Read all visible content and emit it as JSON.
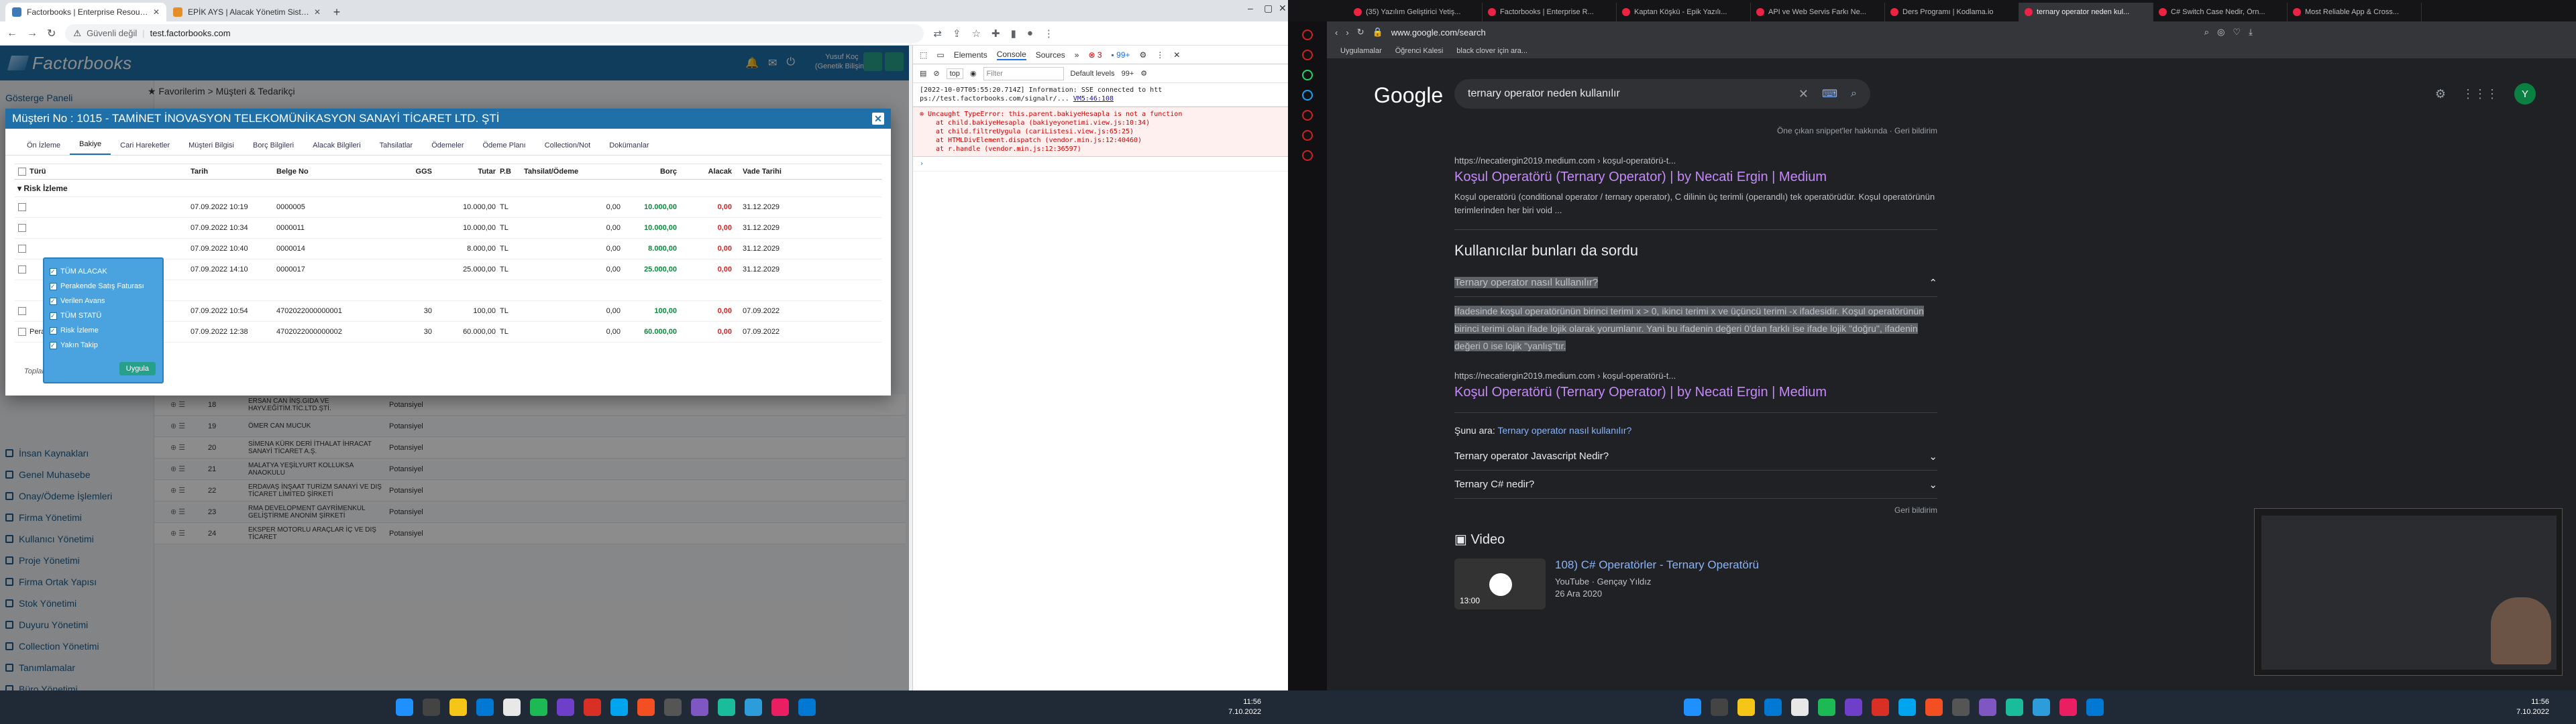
{
  "left_browser": {
    "tabs": [
      {
        "title": "Factorbooks | Enterprise Resource...",
        "active": true
      },
      {
        "title": "EPİK AYS | Alacak Yönetim Siste...",
        "active": false
      }
    ],
    "security": "Güvenli değil",
    "url": "test.factorbooks.com"
  },
  "app": {
    "brand": "Factorbooks",
    "user_name": "Yusuf Koç",
    "user_org": "(Genetik Bilişim)",
    "breadcrumb": "Favorilerim > Müşteri & Tedarikçi",
    "sidebar_top": "Gösterge Paneli",
    "sidebar_items": [
      "İnsan Kaynakları",
      "Genel Muhasebe",
      "Onay/Ödeme İşlemleri",
      "Firma Yönetimi",
      "Kullanıcı Yönetimi",
      "Proje Yönetimi",
      "Firma Ortak Yapısı",
      "Stok Yönetimi",
      "Duyuru Yönetimi",
      "Collection Yönetimi",
      "Tanımlamalar",
      "Büro Yönetimi"
    ],
    "bg_rows": [
      {
        "no": "18",
        "name": "ERSAN CAN İNŞ.GIDA VE HAYV.EĞİTİM.TİC.LTD.ŞTİ.",
        "status": "Potansiyel"
      },
      {
        "no": "19",
        "name": "Ömer Can Mucuk",
        "status": "Potansiyel"
      },
      {
        "no": "20",
        "name": "SİMENA KÜRK DERİ İTHALAT İHRACAT SANAYİ TİCARET A.Ş.",
        "status": "Potansiyel"
      },
      {
        "no": "21",
        "name": "MALATYA YEŞİLYURT KOLLUKSA ANAOKULU",
        "status": "Potansiyel"
      },
      {
        "no": "22",
        "name": "ERDAVAŞ İNŞAAT TURİZM SANAYİ VE DIŞ TİCARET LİMİTED ŞİRKETİ",
        "status": "Potansiyel"
      },
      {
        "no": "23",
        "name": "RMA DEVELOPMENT GAYRİMENKUL GELİŞTİRME ANONİM ŞİRKETİ",
        "status": "Potansiyel"
      },
      {
        "no": "24",
        "name": "EKSPER MOTORLU ARAÇLAR İÇ VE DIŞ TİCARET",
        "status": "Potansiyel"
      }
    ]
  },
  "modal": {
    "title": "Müşteri No : 1015 - TAMİNET İNOVASYON TELEKOMÜNİKASYON SANAYİ TİCARET LTD. ŞTİ",
    "tabs": [
      "Ön İzleme",
      "Bakiye",
      "Cari Hareketler",
      "Müşteri Bilgisi",
      "Borç Bilgileri",
      "Alacak Bilgileri",
      "Tahsilatlar",
      "Ödemeler",
      "Ödeme Planı",
      "Collection/Not",
      "Dokümanlar"
    ],
    "active_tab": "Bakiye",
    "columns": [
      "Türü",
      "Tarih",
      "Belge No",
      "GGS",
      "Tutar",
      "P.B",
      "Tahsilat/Ödeme",
      "Borç",
      "Alacak",
      "Vade Tarihi"
    ],
    "group": "Risk İzleme",
    "rows": [
      {
        "type": "",
        "date": "07.09.2022 10:19",
        "doc": "0000005",
        "ggs": "",
        "amount": "10.000,00",
        "pb": "TL",
        "tahsilat": "",
        "borc_a": "0,00",
        "borc": "10.000,00",
        "alacak": "0,00",
        "vade": "31.12.2029"
      },
      {
        "type": "",
        "date": "07.09.2022 10:34",
        "doc": "0000011",
        "ggs": "",
        "amount": "10.000,00",
        "pb": "TL",
        "tahsilat": "",
        "borc_a": "0,00",
        "borc": "10.000,00",
        "alacak": "0,00",
        "vade": "31.12.2029"
      },
      {
        "type": "",
        "date": "07.09.2022 10:40",
        "doc": "0000014",
        "ggs": "",
        "amount": "8.000,00",
        "pb": "TL",
        "tahsilat": "",
        "borc_a": "0,00",
        "borc": "8.000,00",
        "alacak": "0,00",
        "vade": "31.12.2029"
      },
      {
        "type": "",
        "date": "07.09.2022 14:10",
        "doc": "0000017",
        "ggs": "",
        "amount": "25.000,00",
        "pb": "TL",
        "tahsilat": "",
        "borc_a": "0,00",
        "borc": "25.000,00",
        "alacak": "0,00",
        "vade": "31.12.2029"
      },
      {
        "type": "",
        "date": "07.09.2022 10:54",
        "doc": "4702022000000001",
        "ggs": "30",
        "amount": "100,00",
        "pb": "TL",
        "tahsilat": "",
        "borc_a": "0,00",
        "borc": "100,00",
        "alacak": "0,00",
        "vade": "07.09.2022"
      },
      {
        "type": "Perakende Satış Faturası",
        "date": "07.09.2022 12:38",
        "doc": "4702022000000002",
        "ggs": "30",
        "amount": "60.000,00",
        "pb": "TL",
        "tahsilat": "",
        "borc_a": "0,00",
        "borc": "60.000,00",
        "alacak": "0,00",
        "vade": "07.09.2022"
      }
    ],
    "footer": "Toplam kayıt sayısı: 6",
    "filter_options": [
      "TÜM ALACAK",
      "Perakende Satış Faturası",
      "Verilen Avans",
      "TÜM STATÜ",
      "Risk İzleme",
      "Yakın Takip"
    ],
    "filter_button": "Uygula"
  },
  "devtools": {
    "tabs": [
      "Elements",
      "Console",
      "Sources"
    ],
    "active_tab": "Console",
    "context": "top",
    "filter_placeholder": "Filter",
    "levels": "Default levels",
    "issues": "99+",
    "errors": "3",
    "log1": "[2022-10-07T05:55:20.714Z] Information: SSE connected to htt ps://test.factorbooks.com/signalr/...",
    "log1_link": "VM5:46:108",
    "err_text": "Uncaught TypeError: this.parent.bakiyeHesapla is not a function",
    "err_stack": [
      "at child.bakiyeHesapla (bakiyeyonetimi.view.js:10:34)",
      "at child.filtreUygula (cariListesi.view.js:65:25)",
      "at HTMLDivElement.dispatch (vendor.min.js:12:40460)",
      "at r.handle (vendor.min.js:12:36597)"
    ]
  },
  "taskbar_left": {
    "time": "11:56",
    "date": "7.10.2022"
  },
  "right_browser": {
    "tabs": [
      {
        "title": "(35) Yazılım Geliştirici Yetiş...",
        "active": false
      },
      {
        "title": "Factorbooks | Enterprise R...",
        "active": false
      },
      {
        "title": "Kaptan Köşkü - Epik Yazılı...",
        "active": false
      },
      {
        "title": "API ve Web Servis Farkı Ne...",
        "active": false
      },
      {
        "title": "Ders Programı | Kodlama.io",
        "active": false
      },
      {
        "title": "ternary operator neden kul...",
        "active": true
      },
      {
        "title": "C# Switch Case Nedir, Örn...",
        "active": false
      },
      {
        "title": "Most Reliable App & Cross...",
        "active": false
      }
    ],
    "url": "www.google.com/search",
    "bookmarks": [
      "Uygulamalar",
      "Öğrenci Kalesi",
      "black clover için ara..."
    ]
  },
  "google": {
    "logo": "Google",
    "query": "ternary operator neden kullanılır",
    "avatar": "Y",
    "feat_note": "Öne çıkan snippet'ler hakkında · Geri bildirim",
    "result1": {
      "url": "https://necatiergin2019.medium.com › koşul-operatörü-t...",
      "title": "Koşul Operatörü (Ternary Operator) | by Necati Ergin | Medium",
      "snippet": "Koşul operatörü (conditional operator / ternary operator), C dilinin üç terimli (operandlı) tek operatörüdür. Koşul operatörünün terimlerinden her biri void ..."
    },
    "paa_title": "Kullanıcılar bunları da sordu",
    "paa_q1": "Ternary operator nasıl kullanılır?",
    "paa_answer": "İfadesinde koşul operatörünün birinci terimi x > 0, ikinci terimi x ve üçüncü terimi -x ifadesidir. Koşul operatörünün birinci terimi olan ifade lojik olarak yorumlanır. Yani bu ifadenin değeri 0'dan farklı ise ifade lojik \"doğru\", ifadenin değeri 0 ise lojik \"yanlış\"tır.",
    "result2": {
      "url": "https://necatiergin2019.medium.com › koşul-operatörü-t...",
      "title": "Koşul Operatörü (Ternary Operator) | by Necati Ergin | Medium"
    },
    "also_search_label": "Şunu ara:",
    "also_search_link": "Ternary operator nasıl kullanılır?",
    "paa_q2": "Ternary operator Javascript Nedir?",
    "paa_q3": "Ternary C# nedir?",
    "feedback": "Geri bildirim",
    "video_section": "Video",
    "video": {
      "title": "108) C# Operatörler - Ternary Operatörü",
      "duration": "13:00",
      "source": "YouTube · Gençay Yıldız",
      "date": "26 Ara 2020"
    }
  },
  "taskbar_right": {
    "time": "11:56",
    "date": "7.10.2022"
  }
}
